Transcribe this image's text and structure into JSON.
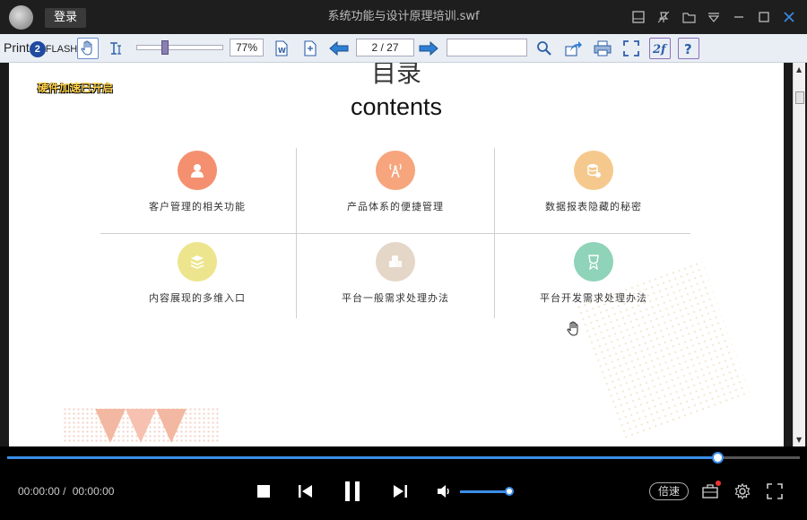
{
  "titlebar": {
    "login_label": "登录",
    "title": "系统功能与设计原理培训.swf",
    "icons": [
      "window-mode-icon",
      "pin-icon",
      "folder-icon",
      "menu-icon",
      "minimize-icon",
      "maximize-icon",
      "close-icon"
    ]
  },
  "toolbar": {
    "brand_print": "Print",
    "brand_two": "2",
    "brand_flash": "FLASH",
    "zoom_value": "77%",
    "page_value": "2 / 27",
    "search_value": "",
    "zoom_level": 0.3
  },
  "document": {
    "hw_badge": "硬件加速已开启",
    "heading_cut": "目录",
    "contents_title": "contents",
    "items": [
      {
        "label": "客户管理的相关功能",
        "color": "#f4906f"
      },
      {
        "label": "产品体系的便捷管理",
        "color": "#f6a57c"
      },
      {
        "label": "数据报表隐藏的秘密",
        "color": "#f5c98d"
      },
      {
        "label": "内容展现的多维入口",
        "color": "#ede58d"
      },
      {
        "label": "平台一般需求处理办法",
        "color": "#e5d7c8"
      },
      {
        "label": "平台开发需求处理办法",
        "color": "#8fd3b8"
      }
    ]
  },
  "player": {
    "current_time": "00:00:00",
    "separator": "/",
    "total_time": "00:00:00",
    "speed_label": "倍速",
    "progress": 0.896,
    "volume": 0.99,
    "accent": "#3b8ee8"
  }
}
